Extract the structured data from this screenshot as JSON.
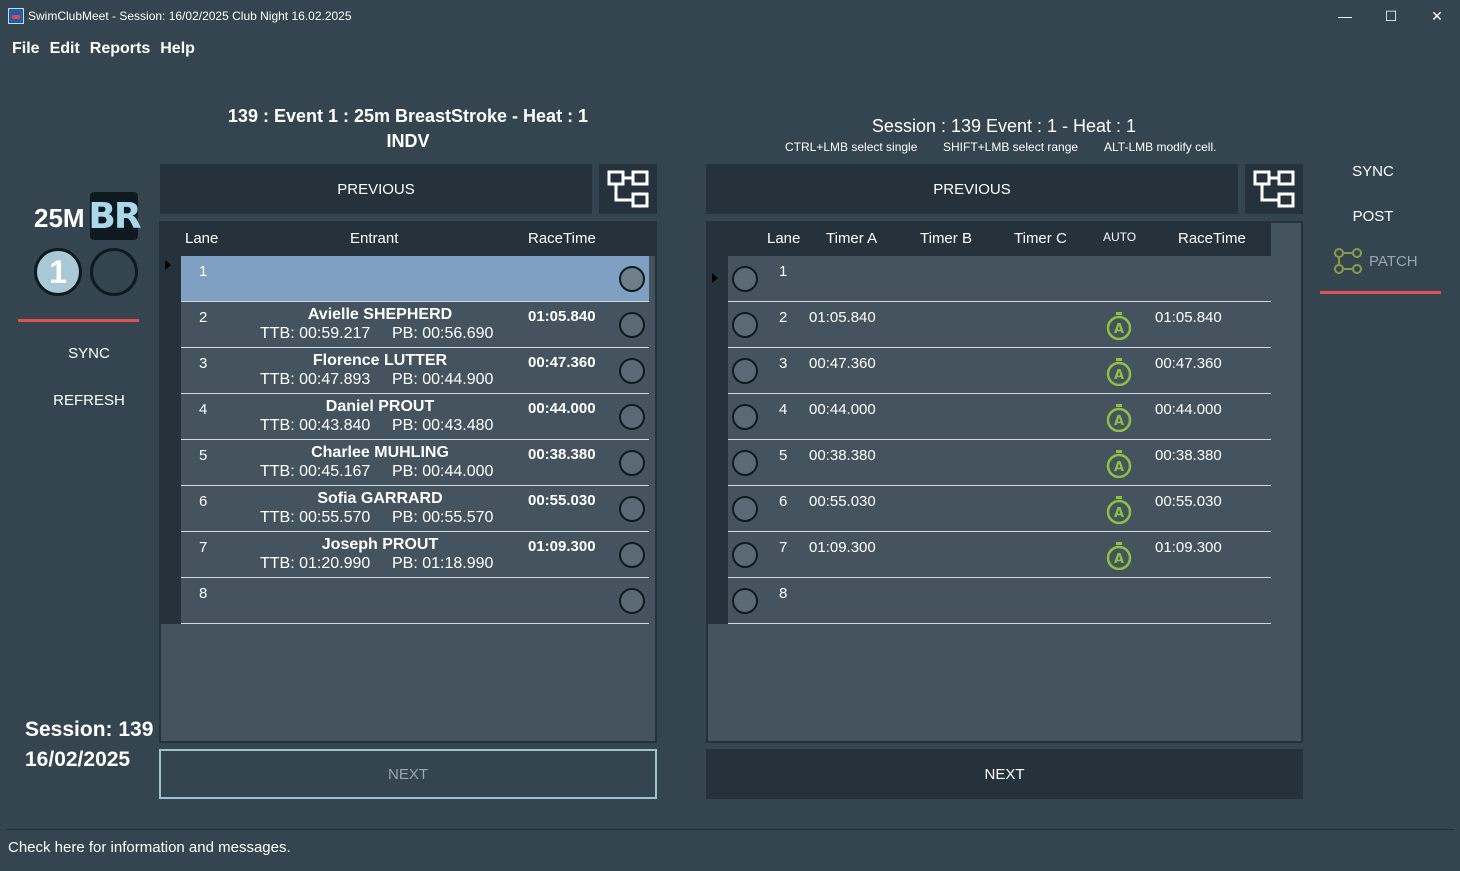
{
  "window": {
    "title": "SwimClubMeet - Session: 16/02/2025 Club Night 16.02.2025",
    "minimize": "—",
    "maximize": "☐",
    "close": "✕"
  },
  "menu": [
    "File",
    "Edit",
    "Reports",
    "Help"
  ],
  "sidebar": {
    "distance": "25M",
    "stroke": "BR",
    "heat_number": "1",
    "sync_label": "SYNC",
    "refresh_label": "REFRESH",
    "session_line": "Session: 139",
    "session_date": "16/02/2025",
    "accent_color": "#e05050"
  },
  "left_panel": {
    "title_line1": "139 : Event 1 : 25m BreastStroke - Heat : 1",
    "title_line2": "INDV",
    "previous_label": "PREVIOUS",
    "next_label": "NEXT",
    "columns": [
      "Lane",
      "Entrant",
      "RaceTime"
    ],
    "rows": [
      {
        "lane": "1",
        "name": "",
        "ttb": "",
        "pb": "",
        "racetime": "",
        "selected": true
      },
      {
        "lane": "2",
        "name": "Avielle SHEPHERD",
        "ttb": "TTB: 00:59.217",
        "pb": "PB: 00:56.690",
        "racetime": "01:05.840"
      },
      {
        "lane": "3",
        "name": "Florence LUTTER",
        "ttb": "TTB: 00:47.893",
        "pb": "PB: 00:44.900",
        "racetime": "00:47.360"
      },
      {
        "lane": "4",
        "name": "Daniel PROUT",
        "ttb": "TTB: 00:43.840",
        "pb": "PB: 00:43.480",
        "racetime": "00:44.000"
      },
      {
        "lane": "5",
        "name": "Charlee MUHLING",
        "ttb": "TTB: 00:45.167",
        "pb": "PB: 00:44.000",
        "racetime": "00:38.380"
      },
      {
        "lane": "6",
        "name": "Sofia GARRARD",
        "ttb": "TTB: 00:55.570",
        "pb": "PB: 00:55.570",
        "racetime": "00:55.030"
      },
      {
        "lane": "7",
        "name": "Joseph PROUT",
        "ttb": "TTB: 01:20.990",
        "pb": "PB: 01:18.990",
        "racetime": "01:09.300"
      },
      {
        "lane": "8",
        "name": "",
        "ttb": "",
        "pb": "",
        "racetime": ""
      }
    ]
  },
  "right_panel": {
    "title": "Session : 139  Event : 1 - Heat : 1",
    "hint_single": "CTRL+LMB select single",
    "hint_range": "SHIFT+LMB select range",
    "hint_modify": "ALT-LMB modify cell.",
    "previous_label": "PREVIOUS",
    "next_label": "NEXT",
    "columns": [
      "Lane",
      "Timer A",
      "Timer B",
      "Timer C",
      "AUTO",
      "RaceTime"
    ],
    "rows": [
      {
        "lane": "1",
        "timer_a": "",
        "timer_b": "",
        "timer_c": "",
        "auto": false,
        "racetime": ""
      },
      {
        "lane": "2",
        "timer_a": "01:05.840",
        "timer_b": "",
        "timer_c": "",
        "auto": true,
        "racetime": "01:05.840"
      },
      {
        "lane": "3",
        "timer_a": "00:47.360",
        "timer_b": "",
        "timer_c": "",
        "auto": true,
        "racetime": "00:47.360"
      },
      {
        "lane": "4",
        "timer_a": "00:44.000",
        "timer_b": "",
        "timer_c": "",
        "auto": true,
        "racetime": "00:44.000"
      },
      {
        "lane": "5",
        "timer_a": "00:38.380",
        "timer_b": "",
        "timer_c": "",
        "auto": true,
        "racetime": "00:38.380"
      },
      {
        "lane": "6",
        "timer_a": "00:55.030",
        "timer_b": "",
        "timer_c": "",
        "auto": true,
        "racetime": "00:55.030"
      },
      {
        "lane": "7",
        "timer_a": "01:09.300",
        "timer_b": "",
        "timer_c": "",
        "auto": true,
        "racetime": "01:09.300"
      },
      {
        "lane": "8",
        "timer_a": "",
        "timer_b": "",
        "timer_c": "",
        "auto": false,
        "racetime": ""
      }
    ]
  },
  "right_sidebar": {
    "sync_label": "SYNC",
    "post_label": "POST",
    "patch_label": "PATCH",
    "patch_icon": "patch-icon",
    "auto_color": "#8fc043"
  },
  "status": {
    "message": "Check here for information and messages."
  }
}
